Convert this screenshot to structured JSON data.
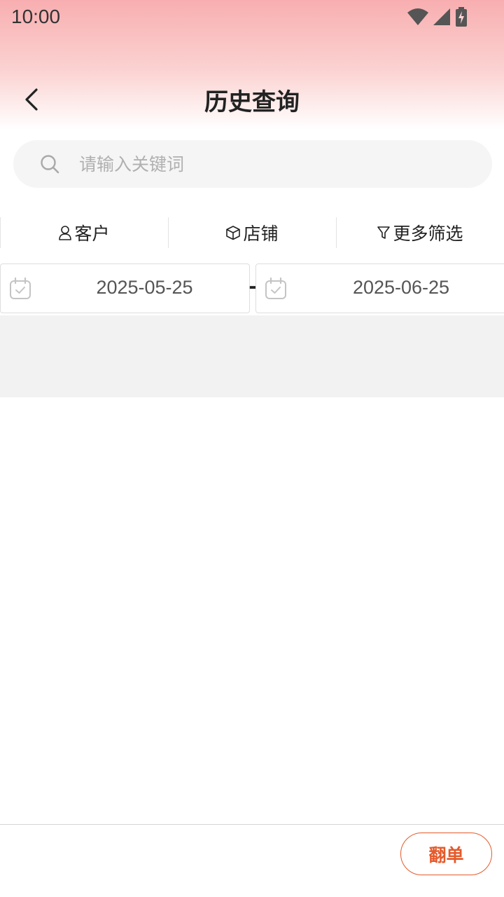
{
  "status_bar": {
    "time": "10:00",
    "icons": [
      "wifi-icon",
      "cellular-signal-icon",
      "battery-charging-icon"
    ]
  },
  "header": {
    "title": "历史查询",
    "back_icon": "chevron-left-icon"
  },
  "search": {
    "placeholder": "请输入关键词",
    "value": "",
    "icon": "search-icon"
  },
  "filters": [
    {
      "label": "客户",
      "icon": "person-icon"
    },
    {
      "label": "店铺",
      "icon": "box-icon"
    },
    {
      "label": "更多筛选",
      "icon": "filter-funnel-icon"
    }
  ],
  "date_range": {
    "start": "2025-05-25",
    "separator": "-",
    "end": "2025-06-25",
    "icon": "calendar-check-icon"
  },
  "footer": {
    "flip_button_label": "翻单"
  },
  "colors": {
    "header_gradient_top": "#f8aeb0",
    "accent": "#e55a2b",
    "search_bg": "#f5f5f5",
    "band_bg": "#f2f2f2"
  }
}
